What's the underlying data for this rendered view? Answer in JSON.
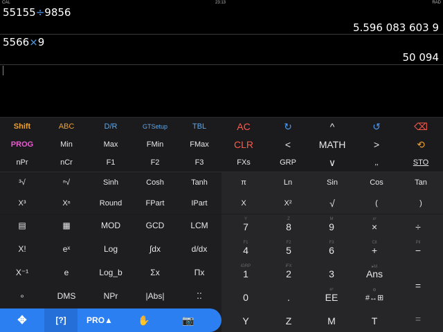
{
  "status": {
    "left": "CAL",
    "time": "23:13",
    "right": "RAD"
  },
  "history": [
    {
      "a": "55155",
      "op": "÷",
      "b": "9856",
      "result": "5.596 083 603 9"
    },
    {
      "a": "5566",
      "op": "×",
      "b": "9",
      "result": "50 094"
    }
  ],
  "row1": [
    "Shift",
    "ABC",
    "D/R",
    "GTSetup",
    "TBL",
    "AC",
    "↻",
    "^",
    "↺",
    "⌫"
  ],
  "row2": [
    "PROG",
    "Min",
    "Max",
    "FMin",
    "FMax",
    "CLR",
    "<",
    "MATH",
    ">",
    "⟲"
  ],
  "row3": [
    "nPr",
    "nCr",
    "F1",
    "F2",
    "F3",
    "FXs",
    "GRP",
    "∨",
    "‚‚",
    "STO"
  ],
  "row4": [
    "³√",
    "ⁿ√",
    "Sinh",
    "Cosh",
    "Tanh",
    "π",
    "Ln",
    "Sin",
    "Cos",
    "Tan"
  ],
  "row5": [
    "X³",
    "Xⁿ",
    "Round",
    "FPart",
    "IPart",
    "X",
    "X²",
    "√",
    "(",
    ")"
  ],
  "left_grid": [
    [
      "▤",
      "▦",
      "MOD",
      "GCD",
      "LCM"
    ],
    [
      "X!",
      "eˣ",
      "Log",
      "∫dx",
      "d/dx"
    ],
    [
      "X⁻¹",
      "e",
      "Log_b",
      "Σx",
      "Πx"
    ],
    [
      "∘",
      "DMS",
      "NPr",
      "|Abs|",
      "⁚⁚"
    ]
  ],
  "right_grid": [
    [
      {
        "s": "Y",
        "k": "7"
      },
      {
        "s": "Z",
        "k": "8"
      },
      {
        "s": "M",
        "k": "9"
      },
      {
        "s": "xʸ",
        "k": "×"
      },
      {
        "s": "",
        "k": "÷"
      }
    ],
    [
      {
        "s": "F1",
        "k": "4"
      },
      {
        "s": "F2",
        "k": "5"
      },
      {
        "s": "F3",
        "k": "6"
      },
      {
        "s": "Cll",
        "k": "+"
      },
      {
        "s": "Pll",
        "k": "−"
      }
    ],
    [
      {
        "s": "iGRP",
        "k": "1"
      },
      {
        "s": "iFX",
        "k": "2"
      },
      {
        "s": "",
        "k": "3"
      },
      {
        "s": "▸M",
        "k": "Ans"
      },
      {
        "s": "",
        "k": "="
      }
    ],
    [
      {
        "s": "",
        "k": "0"
      },
      {
        "s": "",
        "k": "."
      },
      {
        "s": "eˣ",
        "k": "EE"
      },
      {
        "s": "⚙",
        "k": "#↔⊞"
      },
      {
        "s": "",
        "k": ""
      }
    ]
  ],
  "bottom_row": [
    "Y",
    "Z",
    "M",
    "T",
    "="
  ],
  "toolbar": {
    "move": "✥",
    "help": "[?]",
    "pro": "PRO▲",
    "hand": "✋",
    "camera": "📷"
  },
  "colors": {
    "shift": "#f0a030",
    "abc": "#f0a030",
    "dr": "#5aa8f0",
    "gtsetup": "#5aa8f0",
    "tbl": "#5aa8f0",
    "prog": "#e85cd0",
    "ac": "#ff5a4a",
    "clr": "#ff5a4a",
    "blue": "#4a9cf5",
    "toolbar": "#2b7ff0"
  }
}
